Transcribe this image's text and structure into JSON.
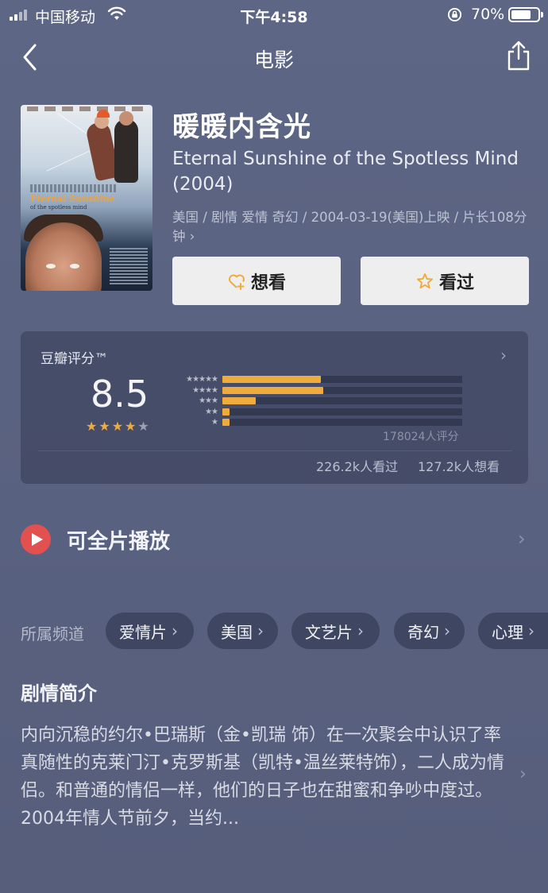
{
  "status_bar": {
    "carrier": "中国移动",
    "time": "下午4:58",
    "battery_percent": "70%",
    "battery_level": 0.7
  },
  "nav": {
    "title": "电影",
    "back_icon": "chevron-left-icon",
    "share_icon": "share-icon"
  },
  "movie": {
    "title_cn": "暖暖内含光",
    "title_en": "Eternal Sunshine of the Spotless Mind (2004)",
    "meta": "美国 / 剧情 爱情 奇幻 / 2004-03-19(美国)上映 / 片长108分钟",
    "poster_title": "Eternal Sunshine",
    "poster_subtitle": "of the spotless mind"
  },
  "actions": {
    "want_label": "想看",
    "watched_label": "看过"
  },
  "rating": {
    "label": "豆瓣评分™",
    "score": "8.5",
    "stars": 4,
    "distribution": [
      0.41,
      0.42,
      0.14,
      0.03,
      0.03
    ],
    "vote_count": "178024人评分",
    "watched_count": "226.2k人看过",
    "want_count": "127.2k人想看",
    "accent_color": "#efab3c"
  },
  "playable": {
    "label": "可全片播放",
    "icon_color": "#e2504f"
  },
  "channels": {
    "label": "所属频道",
    "items": [
      "爱情片",
      "美国",
      "文艺片",
      "奇幻",
      "心理"
    ]
  },
  "synopsis": {
    "title": "剧情简介",
    "text": "内向沉稳的约尔•巴瑞斯（金•凯瑞 饰）在一次聚会中认识了率真随性的克莱门汀•克罗斯基（凯特•温丝莱特饰），二人成为情侣。和普通的情侣一样，他们的日子也在甜蜜和争吵中度过。2004年情人节前夕，当约..."
  }
}
